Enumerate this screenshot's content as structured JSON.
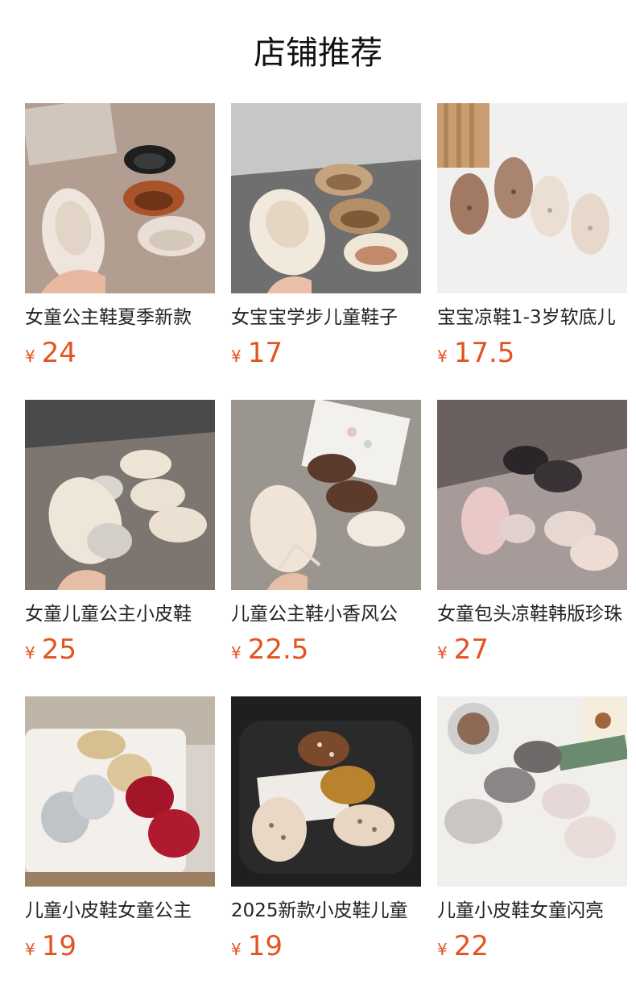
{
  "header": {
    "title": "店铺推荐"
  },
  "currency": "¥",
  "products": [
    {
      "name": "女童公主鞋夏季新款",
      "price": "24",
      "image": "woven-mary-janes-white-brown-black"
    },
    {
      "name": "女宝宝学步儿童鞋子",
      "price": "17",
      "image": "cream-tan-mary-janes-on-gray-chair"
    },
    {
      "name": "宝宝凉鞋1-3岁软底儿",
      "price": "17.5",
      "image": "woven-sandals-bronze-cream"
    },
    {
      "name": "女童儿童公主小皮鞋",
      "price": "25",
      "image": "glitter-toe-mary-janes-cream"
    },
    {
      "name": "儿童公主鞋小香风公",
      "price": "22.5",
      "image": "bow-mary-janes-cream-brown"
    },
    {
      "name": "女童包头凉鞋韩版珍珠",
      "price": "27",
      "image": "sparkly-bow-sandals-pink-black"
    },
    {
      "name": "儿童小皮鞋女童公主",
      "price": "19",
      "image": "bow-flats-gold-silver-red"
    },
    {
      "name": "2025新款小皮鞋儿童",
      "price": "19",
      "image": "polka-dot-mary-janes-brown-mustard-pink"
    },
    {
      "name": "儿童小皮鞋女童闪亮",
      "price": "22",
      "image": "glitter-mary-janes-silver-black-pink"
    }
  ]
}
